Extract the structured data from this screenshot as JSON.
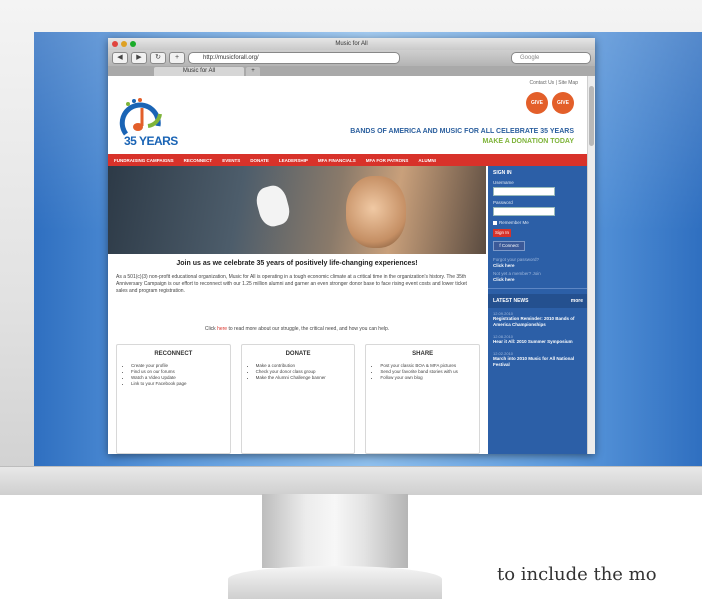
{
  "browser": {
    "window_title": "Music for All",
    "url": "http://musicforall.org/",
    "search_placeholder": "Google",
    "tab_label": "Music for All",
    "new_tab_label": "+"
  },
  "site": {
    "util_links": "Contact Us | Site Map",
    "logo_text": "35 YEARS",
    "badges": [
      "GIVE",
      "GIVE"
    ],
    "tagline_line1": "BANDS OF AMERICA AND MUSIC FOR ALL CELEBRATE 35 YEARS",
    "tagline_line2": "MAKE A DONATION TODAY",
    "nav": [
      "FUNDRAISING CAMPAIGNS",
      "RECONNECT",
      "EVENTS",
      "DONATE",
      "LEADERSHIP",
      "MFA FINANCIALS",
      "MFA FOR PATRONS",
      "ALUMNI"
    ],
    "lead": "Join us as we celebrate 35 years of positively life-changing experiences!",
    "body": "As a 501(c)(3) non-profit educational organization, Music for All is operating in a tough economic climate at a critical time in the organization's history. The 35th Anniversary Campaign is our effort to reconnect with our 1.25 million alumni and garner an even stronger donor base to face rising event costs and lower ticket sales and program registration.",
    "click_prefix": "Click",
    "click_link": "here",
    "click_suffix": "to read more about our struggle, the critical need, and how you can help.",
    "boxes": [
      {
        "title": "RECONNECT",
        "items": [
          "Create your profile",
          "Find us on our forums",
          "Watch a Video Update",
          "Link to your Facebook page"
        ]
      },
      {
        "title": "DONATE",
        "items": [
          "Make a contribution",
          "Check your donor class group",
          "Make the Alumni Challenge banner"
        ]
      },
      {
        "title": "SHARE",
        "items": [
          "Post your classic BOA & MFA pictures",
          "Send your favorite band stories with us",
          "Follow your own blog"
        ]
      }
    ],
    "sidebar": {
      "heading": "SIGN IN",
      "username_label": "Username",
      "password_label": "Password",
      "remember_label": "Remember Me",
      "signin_button": "Sign In",
      "facebook_button": "f Connect",
      "small1": "Forgot your password?",
      "link1": "Click here",
      "small2": "Not yet a member? Join",
      "link2": "Click here",
      "news_heading": "LATEST NEWS",
      "news_more": "more",
      "news": [
        {
          "date": "12.09.2010",
          "title": "Registration Reminder: 2010 Bands of America Championships"
        },
        {
          "date": "12.08.2010",
          "title": "Hear it All: 2010 Summer Symposium"
        },
        {
          "date": "12.02.2010",
          "title": "March into 2010 Music for All National Festival"
        }
      ]
    }
  },
  "caption": "to include the mo"
}
